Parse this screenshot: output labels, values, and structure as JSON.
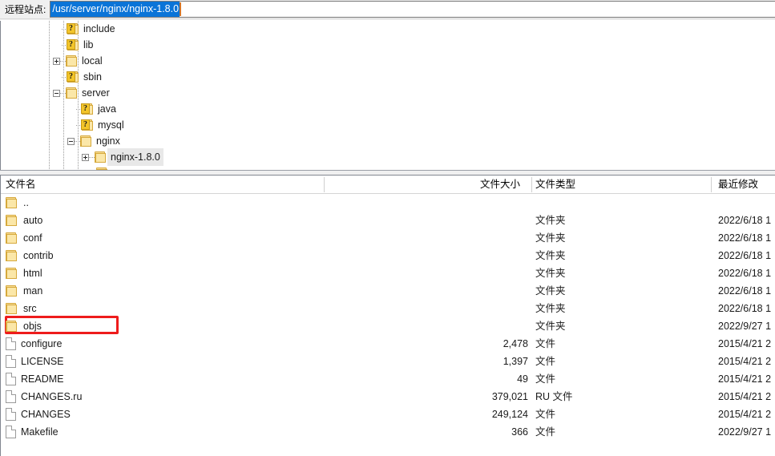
{
  "address_bar": {
    "label": "远程站点:",
    "value": "/usr/server/nginx/nginx-1.8.0"
  },
  "tree": {
    "items": [
      {
        "label": "include",
        "indent": 3,
        "icon": "folder-question-icon",
        "expander": "none"
      },
      {
        "label": "lib",
        "indent": 3,
        "icon": "folder-question-icon",
        "expander": "none"
      },
      {
        "label": "local",
        "indent": 3,
        "icon": "folder-icon",
        "expander": "plus"
      },
      {
        "label": "sbin",
        "indent": 3,
        "icon": "folder-question-icon",
        "expander": "none"
      },
      {
        "label": "server",
        "indent": 3,
        "icon": "folder-icon",
        "expander": "minus"
      },
      {
        "label": "java",
        "indent": 4,
        "icon": "folder-question-icon",
        "expander": "none"
      },
      {
        "label": "mysql",
        "indent": 4,
        "icon": "folder-question-icon",
        "expander": "none"
      },
      {
        "label": "nginx",
        "indent": 4,
        "icon": "folder-icon",
        "expander": "minus"
      },
      {
        "label": "nginx-1.8.0",
        "indent": 5,
        "icon": "folder-icon",
        "expander": "plus",
        "selected": true
      },
      {
        "label": "..",
        "indent": 5,
        "icon": "folder-icon",
        "expander": "none"
      }
    ]
  },
  "file_list": {
    "columns": [
      "文件名",
      "文件大小",
      "文件类型",
      "最近修改"
    ],
    "rows": [
      {
        "name": "..",
        "size": "",
        "type": "",
        "date": "",
        "icon": "folder-icon"
      },
      {
        "name": "auto",
        "size": "",
        "type": "文件夹",
        "date": "2022/6/18 1",
        "icon": "folder-icon"
      },
      {
        "name": "conf",
        "size": "",
        "type": "文件夹",
        "date": "2022/6/18 1",
        "icon": "folder-icon"
      },
      {
        "name": "contrib",
        "size": "",
        "type": "文件夹",
        "date": "2022/6/18 1",
        "icon": "folder-icon"
      },
      {
        "name": "html",
        "size": "",
        "type": "文件夹",
        "date": "2022/6/18 1",
        "icon": "folder-icon"
      },
      {
        "name": "man",
        "size": "",
        "type": "文件夹",
        "date": "2022/6/18 1",
        "icon": "folder-icon"
      },
      {
        "name": "src",
        "size": "",
        "type": "文件夹",
        "date": "2022/6/18 1",
        "icon": "folder-icon"
      },
      {
        "name": "objs",
        "size": "",
        "type": "文件夹",
        "date": "2022/9/27 1",
        "icon": "folder-icon",
        "highlighted": true
      },
      {
        "name": "configure",
        "size": "2,478",
        "type": "文件",
        "date": "2015/4/21 2",
        "icon": "file-icon"
      },
      {
        "name": "LICENSE",
        "size": "1,397",
        "type": "文件",
        "date": "2015/4/21 2",
        "icon": "file-icon"
      },
      {
        "name": "README",
        "size": "49",
        "type": "文件",
        "date": "2015/4/21 2",
        "icon": "file-icon"
      },
      {
        "name": "CHANGES.ru",
        "size": "379,021",
        "type": "RU 文件",
        "date": "2015/4/21 2",
        "icon": "file-icon"
      },
      {
        "name": "CHANGES",
        "size": "249,124",
        "type": "文件",
        "date": "2015/4/21 2",
        "icon": "file-icon"
      },
      {
        "name": "Makefile",
        "size": "366",
        "type": "文件",
        "date": "2022/9/27 1",
        "icon": "file-icon"
      }
    ]
  },
  "annotation": {
    "color": "#ee1c1c",
    "target": "objs"
  }
}
